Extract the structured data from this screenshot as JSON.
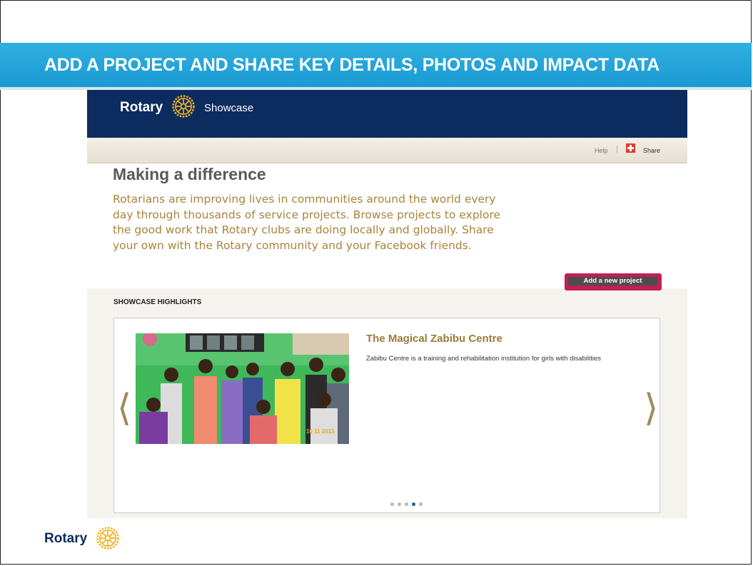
{
  "slide": {
    "title": "ADD A PROJECT AND SHARE KEY DETAILS, PHOTOS AND IMPACT DATA",
    "footer_brand": "Rotary"
  },
  "site": {
    "brand_name": "Rotary",
    "product_name": "Showcase",
    "logo_icon": "rotary-wheel-icon"
  },
  "utility_bar": {
    "help_label": "Help",
    "separator": "|",
    "share_label": "Share",
    "share_icon": "plus-icon"
  },
  "intro": {
    "heading": "Making a difference",
    "text": "Rotarians are improving lives in communities around the world every day through thousands of service projects. Browse projects to explore the good work that Rotary clubs are doing locally and globally. Share your own with the Rotary community and your Facebook friends."
  },
  "actions": {
    "add_project_label": "Add a new project"
  },
  "highlights": {
    "title": "SHOWCASE HIGHLIGHTS",
    "active_slide": {
      "title": "The Magical Zabibu Centre",
      "description": "Zabibu Centre is a training and rehabilitation institution for girls with disabilities",
      "photo_date": "10 11 2013"
    },
    "prev_arrow": "⟨",
    "next_arrow": "⟩",
    "slide_count": 5,
    "active_index": 3
  },
  "colors": {
    "title_bar": "#1a9ad4",
    "site_header": "#0c2b5e",
    "accent_gold": "#a8843a",
    "add_button": "#c51d57"
  }
}
